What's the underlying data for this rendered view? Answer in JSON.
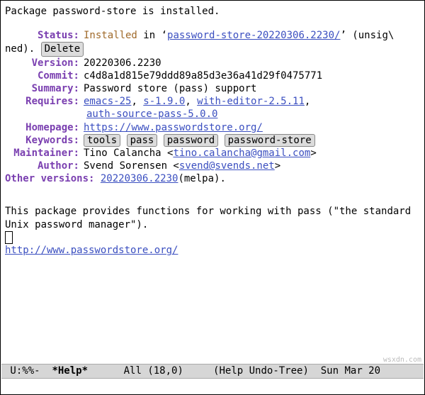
{
  "header": "Package password-store is installed.",
  "fields": {
    "status_label": "Status:",
    "status_value": "Installed",
    "status_in": "in '",
    "status_dir": "password-store-20220306.2230/",
    "status_after": "' (unsig\\",
    "status_line2": "ned).",
    "delete_btn": "Delete",
    "version_label": "Version:",
    "version_value": "20220306.2230",
    "commit_label": "Commit:",
    "commit_value": "c4d8a1d815e79ddd89a85d3e36a41d29f0475771",
    "summary_label": "Summary:",
    "summary_value": "Password store (pass) support",
    "requires_label": "Requires:",
    "requires_1": "emacs-25",
    "requires_2": "s-1.9.0",
    "requires_3": "with-editor-2.5.11",
    "requires_4": "auth-source-pass-5.0.0",
    "homepage_label": "Homepage:",
    "homepage_value": "https://www.passwordstore.org/",
    "keywords_label": "Keywords:",
    "kw_1": "tools",
    "kw_2": "pass",
    "kw_3": "password",
    "kw_4": "password-store",
    "maint_label": "Maintainer:",
    "maint_name": "Tino Calancha <",
    "maint_email": "tino.calancha@gmail.com",
    "maint_close": ">",
    "author_label": "Author:",
    "author_name": "Svend Sorensen <",
    "author_email": "svend@svends.net",
    "author_close": ">",
    "other_label": "Other versions:",
    "other_version": "20220306.2230",
    "other_source": " (melpa)."
  },
  "description": {
    "para": "This package provides functions for working with pass (\"the standard Unix password manager\").",
    "url": "http://www.passwordstore.org/"
  },
  "modeline": {
    "left": " U:%%- ",
    "bufname": " *Help*",
    "pos": "      All (18,0)     (Help Undo-Tree)  Sun Mar 20"
  },
  "watermark": "wsxdn.com"
}
